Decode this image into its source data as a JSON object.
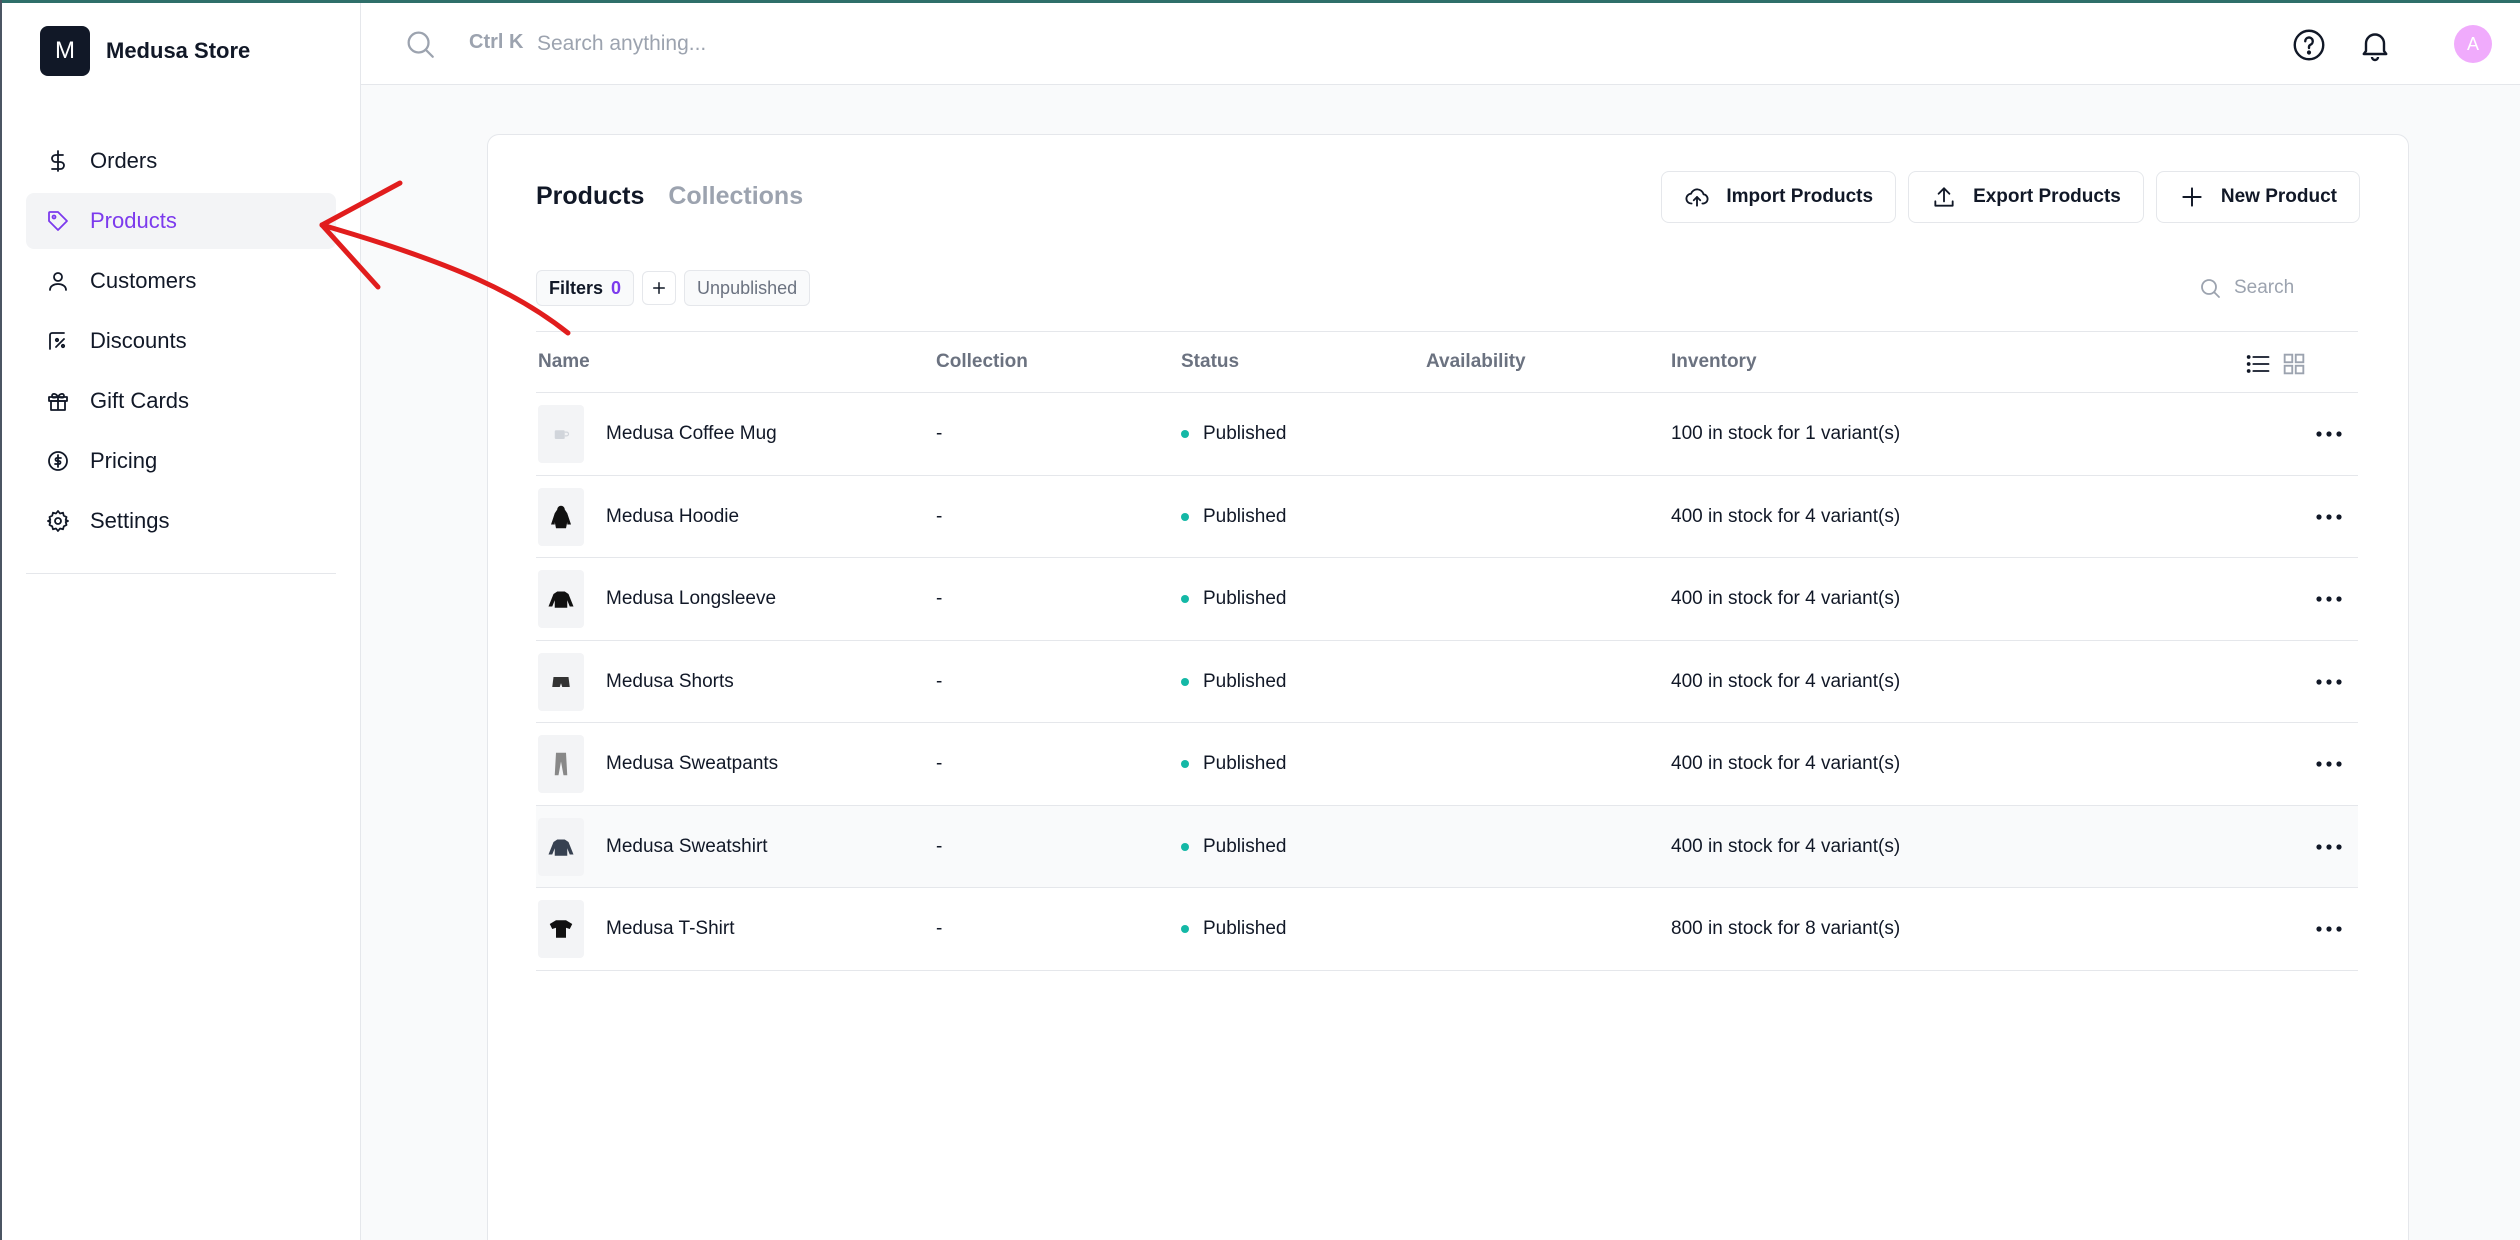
{
  "store": {
    "initial": "M",
    "name": "Medusa Store"
  },
  "nav": [
    {
      "label": "Orders",
      "icon": "dollar-icon"
    },
    {
      "label": "Products",
      "icon": "tag-icon",
      "active": true
    },
    {
      "label": "Customers",
      "icon": "user-icon"
    },
    {
      "label": "Discounts",
      "icon": "discount-icon"
    },
    {
      "label": "Gift Cards",
      "icon": "gift-icon"
    },
    {
      "label": "Pricing",
      "icon": "coin-icon"
    },
    {
      "label": "Settings",
      "icon": "gear-icon"
    }
  ],
  "topbar": {
    "shortcut": "Ctrl K",
    "search_placeholder": "Search anything...",
    "user_initial": "A"
  },
  "tabs": {
    "products": "Products",
    "collections": "Collections"
  },
  "actions": {
    "import": "Import Products",
    "export": "Export Products",
    "new": "New Product"
  },
  "filters": {
    "label": "Filters",
    "count": "0",
    "unpublished": "Unpublished",
    "search_placeholder": "Search"
  },
  "table": {
    "headers": {
      "name": "Name",
      "collection": "Collection",
      "status": "Status",
      "availability": "Availability",
      "inventory": "Inventory"
    },
    "rows": [
      {
        "name": "Medusa Coffee Mug",
        "collection": "-",
        "status": "Published",
        "inventory": "100 in stock for 1 variant(s)",
        "icon": "mug-icon"
      },
      {
        "name": "Medusa Hoodie",
        "collection": "-",
        "status": "Published",
        "inventory": "400 in stock for 4 variant(s)",
        "icon": "hoodie-icon"
      },
      {
        "name": "Medusa Longsleeve",
        "collection": "-",
        "status": "Published",
        "inventory": "400 in stock for 4 variant(s)",
        "icon": "longsleeve-icon"
      },
      {
        "name": "Medusa Shorts",
        "collection": "-",
        "status": "Published",
        "inventory": "400 in stock for 4 variant(s)",
        "icon": "shorts-icon"
      },
      {
        "name": "Medusa Sweatpants",
        "collection": "-",
        "status": "Published",
        "inventory": "400 in stock for 4 variant(s)",
        "icon": "sweatpants-icon"
      },
      {
        "name": "Medusa Sweatshirt",
        "collection": "-",
        "status": "Published",
        "inventory": "400 in stock for 4 variant(s)",
        "icon": "sweatshirt-icon"
      },
      {
        "name": "Medusa T-Shirt",
        "collection": "-",
        "status": "Published",
        "inventory": "800 in stock for 8 variant(s)",
        "icon": "tshirt-icon"
      }
    ]
  },
  "colors": {
    "accent": "#7c3aed",
    "published": "#14b8a6",
    "arrow": "#e11d1d"
  }
}
